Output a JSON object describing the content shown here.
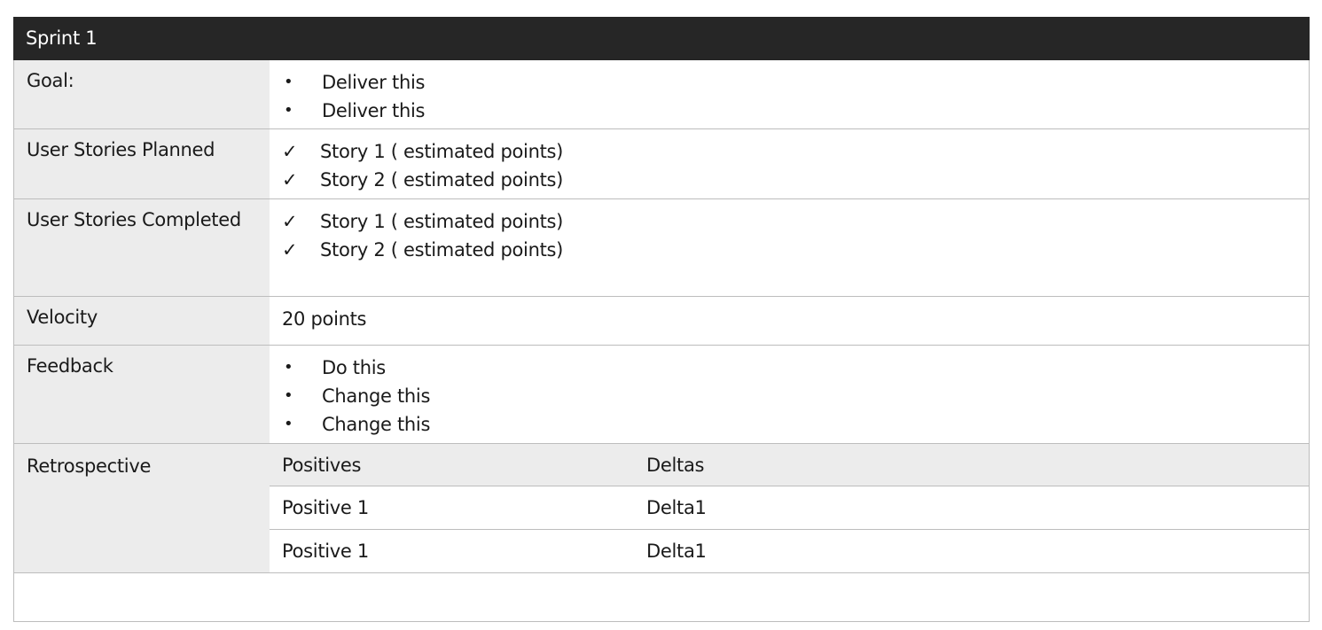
{
  "title": "Sprint 1",
  "rows": {
    "goal": {
      "label": "Goal:",
      "items": [
        "Deliver this",
        "Deliver this"
      ],
      "marker": "•"
    },
    "planned": {
      "label": "User Stories Planned",
      "items": [
        "Story 1 ( estimated points)",
        "Story 2 ( estimated points)"
      ],
      "marker": "✓"
    },
    "completed": {
      "label": "User Stories Completed",
      "items": [
        "Story 1 ( estimated points)",
        "Story 2 ( estimated points)"
      ],
      "marker": "✓"
    },
    "velocity": {
      "label": "Velocity",
      "value": "20 points"
    },
    "feedback": {
      "label": "Feedback",
      "items": [
        "Do this",
        "Change this",
        "Change this"
      ],
      "marker": "•"
    },
    "retrospective": {
      "label": "Retrospective",
      "headers": [
        "Positives",
        "Deltas"
      ],
      "rows": [
        [
          "Positive 1",
          "Delta1"
        ],
        [
          "Positive 1",
          "Delta1"
        ]
      ]
    }
  },
  "colors": {
    "title_bar": "#262626",
    "label_bg": "#ececec",
    "border": "#bdbdbd"
  }
}
